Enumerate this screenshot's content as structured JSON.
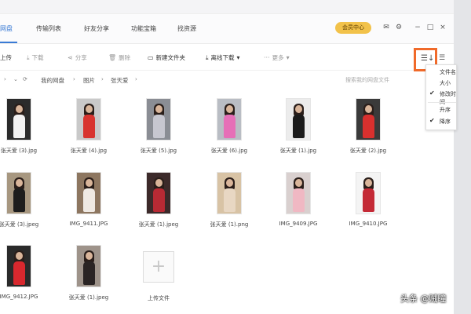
{
  "nav": {
    "tabs": [
      {
        "label": "网盘",
        "active": true
      },
      {
        "label": "传输列表"
      },
      {
        "label": "好友分享"
      },
      {
        "label": "功能宝箱"
      },
      {
        "label": "找资源"
      }
    ],
    "vip_label": "会员中心"
  },
  "window_controls": {
    "mail": "✉",
    "settings": "⚙",
    "minimize": "−",
    "maximize": "□",
    "close": "×"
  },
  "toolbar": {
    "upload": "上传",
    "download": "下载",
    "share": "分享",
    "delete": "删除",
    "new_folder": "新建文件夹",
    "offline_download": "离线下载",
    "more": "更多",
    "sort_icon": "☰↓",
    "list_view_icon": "☰"
  },
  "breadcrumb": {
    "items": [
      "我的网盘",
      "图片",
      "张天爱"
    ],
    "search_placeholder": "搜索我的网盘文件"
  },
  "sort_menu": {
    "items": [
      {
        "label": "文件名",
        "checked": false
      },
      {
        "label": "大小",
        "checked": false
      },
      {
        "label": "修改时间",
        "checked": true
      },
      {
        "label": "升序",
        "checked": false
      },
      {
        "label": "降序",
        "checked": true
      }
    ],
    "check_mark": "✔"
  },
  "files": [
    {
      "name": "张天爱 (3).jpg",
      "bg": "#2b2b2b",
      "body": "#f2f2f2"
    },
    {
      "name": "张天爱 (4).jpg",
      "bg": "#c9c9c9",
      "body": "#d8342f"
    },
    {
      "name": "张天爱 (5).jpg",
      "bg": "#8a8d94",
      "body": "#c7c7d0"
    },
    {
      "name": "张天爱 (6).jpg",
      "bg": "#b9bdc4",
      "body": "#e66fb7"
    },
    {
      "name": "张天爱 (1).jpg",
      "bg": "#ececec",
      "body": "#1b1b1b"
    },
    {
      "name": "张天爱 (2).jpg",
      "bg": "#3a3a3a",
      "body": "#d8302e"
    },
    {
      "name": "张天爱 (3).jpeg",
      "bg": "#a79780",
      "body": "#1d1d1d"
    },
    {
      "name": "IMG_9411.JPG",
      "bg": "#8d7660",
      "body": "#efe9e3"
    },
    {
      "name": "张天爱 (1).jpeg",
      "bg": "#3c2a2a",
      "body": "#b82a34"
    },
    {
      "name": "张天爱 (1).png",
      "bg": "#d8c3a5",
      "body": "#e8d7c3"
    },
    {
      "name": "IMG_9409.JPG",
      "bg": "#d9d0cf",
      "body": "#f0b8c3"
    },
    {
      "name": "IMG_9410.JPG",
      "bg": "#f4f4f4",
      "body": "#c42a36"
    },
    {
      "name": "IMG_9412.JPG",
      "bg": "#2a2a2a",
      "body": "#d8282e"
    },
    {
      "name": "张天爱 (1).jpeg",
      "bg": "#9e938a",
      "body": "#2a2424"
    }
  ],
  "upload_tile": {
    "label": "上传文件",
    "icon": "+"
  },
  "watermark": "头条 @贼瞳"
}
